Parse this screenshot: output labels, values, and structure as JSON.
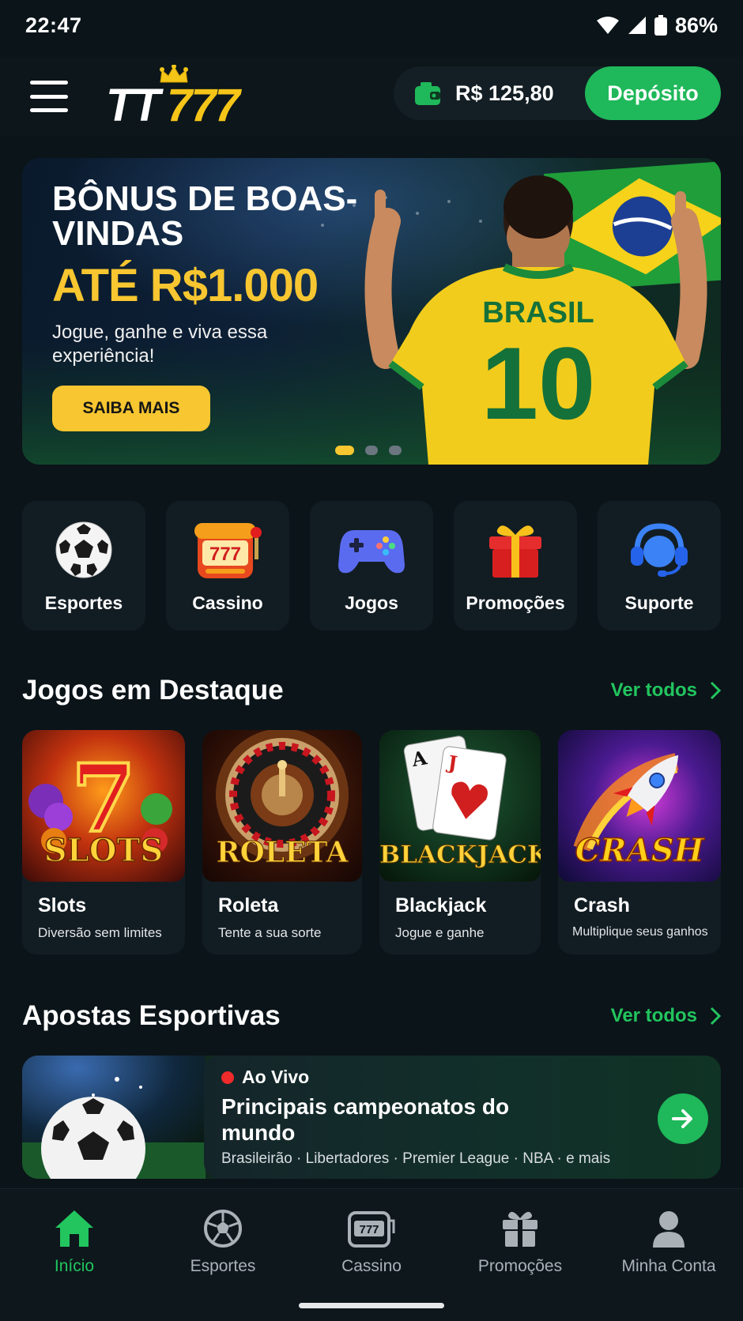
{
  "status_bar": {
    "time": "22:47",
    "battery": "86%"
  },
  "header": {
    "logo_tt": "TT",
    "logo_777": "777",
    "balance": "R$ 125,80",
    "deposit_label": "Depósito"
  },
  "banner": {
    "title": "BÔNUS DE BOAS-VINDAS",
    "amount": "ATÉ R$1.000",
    "subtitle": "Jogue, ganhe e viva essa experiência!",
    "cta_label": "SAIBA MAIS",
    "jersey_name": "BRASIL",
    "jersey_number": "10",
    "slide_count": 3,
    "active_slide": 1
  },
  "categories": [
    {
      "label": "Esportes",
      "icon": "soccer-ball-icon"
    },
    {
      "label": "Cassino",
      "icon": "slot-machine-icon"
    },
    {
      "label": "Jogos",
      "icon": "gamepad-icon"
    },
    {
      "label": "Promoções",
      "icon": "gift-icon"
    },
    {
      "label": "Suporte",
      "icon": "headset-icon"
    }
  ],
  "featured": {
    "title": "Jogos em Destaque",
    "see_all": "Ver todos",
    "games": [
      {
        "name": "Slots",
        "desc": "Diversão sem limites",
        "thumb_label": "SLOTS",
        "thumb_number": "7"
      },
      {
        "name": "Roleta",
        "desc": "Tente a sua sorte",
        "thumb_label": "ROLETA"
      },
      {
        "name": "Blackjack",
        "desc": "Jogue e ganhe",
        "thumb_label": "BLACKJACK",
        "card_a": "A",
        "card_j": "J"
      },
      {
        "name": "Crash",
        "desc": "Multiplique seus ganhos",
        "thumb_label": "CRASH"
      }
    ]
  },
  "sports": {
    "title": "Apostas Esportivas",
    "see_all": "Ver todos",
    "live_label": "Ao Vivo",
    "card_title": "Principais campeonatos do mundo",
    "leagues": "Brasileirão · Libertadores · Premier League · NBA · e mais"
  },
  "bottom_nav": [
    {
      "label": "Início",
      "icon": "home-icon",
      "active": true
    },
    {
      "label": "Esportes",
      "icon": "soccer-ball-icon",
      "active": false
    },
    {
      "label": "Cassino",
      "icon": "slot-machine-icon",
      "active": false
    },
    {
      "label": "Promoções",
      "icon": "gift-icon",
      "active": false
    },
    {
      "label": "Minha Conta",
      "icon": "user-icon",
      "active": false
    }
  ],
  "colors": {
    "background": "#0b1419",
    "accent_green": "#1fb85a",
    "accent_yellow": "#f7c630",
    "card": "#121d23"
  }
}
